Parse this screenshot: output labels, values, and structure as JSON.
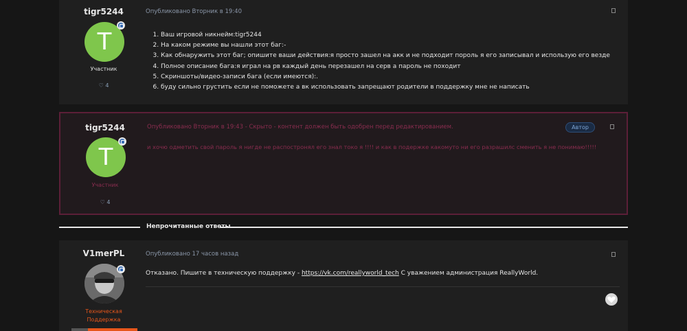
{
  "posts": [
    {
      "author": "tigr5244",
      "avatar_letter": "T",
      "role": "Участник",
      "rep": "4",
      "meta": "Опубликовано Вторник в 19:40",
      "lines": [
        "Ваш игровой никнейм:tigr5244",
        "На каком режиме вы нашли этот баг:-",
        "Как обнаружить этот баг; опишите ваши действия:я просто зашел на акк и не подходит пороль я его записывал и использую его везде",
        "Полное описание бага:я играл на рв каждый день перезашел на серв а пароль не походит",
        "Скриншоты/видео-записи бага (если имеются):.",
        "буду сильно грустить если не поможете а вк использовать запрещают родители в поддержку мне не написать"
      ]
    },
    {
      "author": "tigr5244",
      "avatar_letter": "T",
      "role": "Участник",
      "rep": "4",
      "meta": "Опубликовано Вторник в 19:43 - Скрыто - контент должен быть одобрен перед редактированием.",
      "badge": "Автор",
      "text": "и хочю одметить свой пароль я нигде не распостронял его знал токо я !!!! и как в подержке какомуто ни его разрашилс сменить я не понимаю!!!!!"
    },
    {
      "author": "V1merPL",
      "role_line1": "Техническая",
      "role_line2": "Поддержка",
      "meta": "Опубликовано 17 часов назад",
      "text_before": "Отказано. Пишите в техническую поддержку - ",
      "link": "https://vk.com/reallyworld_tech",
      "text_after": " С уважением администрация ReallyWorld."
    }
  ],
  "divider": {
    "label": "Непрочитанные ответы"
  },
  "icons": {
    "status": "staff-badge-icon",
    "rep": "heart-icon",
    "menu": "post-menu-icon",
    "like": "heart-like-icon"
  },
  "colors": {
    "page_bg": "#161616",
    "post_bg": "#1f1f1f",
    "hidden_border": "#5c1f38",
    "hidden_text": "#8a2d4f",
    "avatar_green": "#7fc64c",
    "staff_orange": "#e8571b"
  }
}
